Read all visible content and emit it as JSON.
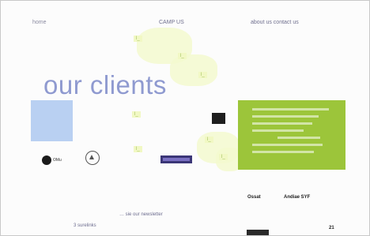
{
  "nav": {
    "home": "home",
    "camp": "CAMP US",
    "about": "about us  contact us"
  },
  "page": {
    "title": "our clients"
  },
  "tags": [
    "l_",
    "l_",
    "l_",
    "l_",
    "l_",
    "l_",
    "l_"
  ],
  "logos": {
    "disk_label": "OMu",
    "right_left": "Ossat",
    "right_right": "Andiae SYF",
    "bottom_right": "21"
  },
  "footer": {
    "newsletter": "… sie our newsletter",
    "link2": "3 surelinks"
  },
  "colors": {
    "accent_green": "#9cc53a",
    "heading": "#8f9ad0",
    "block_blue": "#b9d0f2",
    "tag_bg": "#f1f8c4"
  }
}
